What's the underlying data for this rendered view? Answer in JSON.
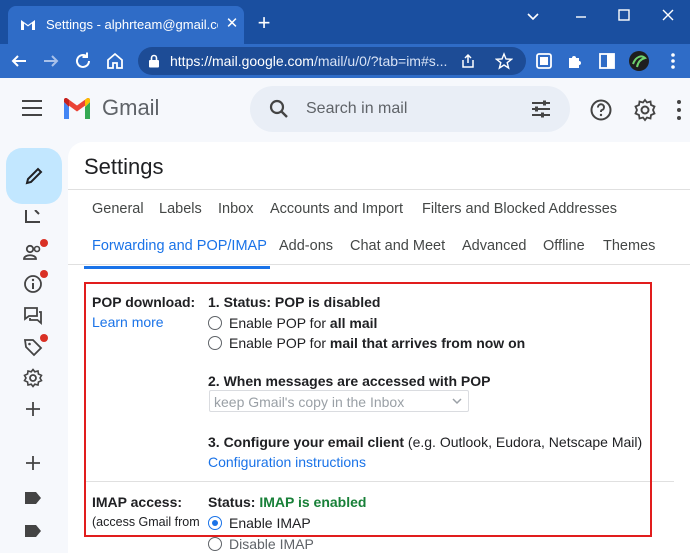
{
  "browser": {
    "tab_title": "Settings - alphrteam@gmail.com",
    "tab_close": "✕",
    "new_tab": "+",
    "url_host": "https://mail.google.com",
    "url_path": "/mail/u/0/?tab=im#s..."
  },
  "gmail": {
    "logo_text": "Gmail",
    "search_placeholder": "Search in mail"
  },
  "settings": {
    "title": "Settings",
    "tabs_row1": [
      "General",
      "Labels",
      "Inbox",
      "Accounts and Import",
      "Filters and Blocked Addresses"
    ],
    "tabs_row2": [
      "Forwarding and POP/IMAP",
      "Add-ons",
      "Chat and Meet",
      "Advanced",
      "Offline",
      "Themes"
    ],
    "active_tab": "Forwarding and POP/IMAP",
    "pop": {
      "label": "POP download:",
      "learn_more": "Learn more",
      "status_heading": "1. Status: POP is disabled",
      "option1_prefix": "Enable POP for ",
      "option1_bold": "all mail",
      "option2_prefix": "Enable POP for ",
      "option2_bold": "mail that arrives from now on",
      "when_heading": "2. When messages are accessed with POP",
      "when_select": "keep Gmail's copy in the Inbox",
      "configure_heading": "3. Configure your email client",
      "configure_examples": " (e.g. Outlook, Eudora, Netscape Mail)",
      "configure_link": "Configuration instructions"
    },
    "imap": {
      "label": "IMAP access:",
      "sublabel": "(access Gmail from",
      "status_prefix": "Status: ",
      "status_value": "IMAP is enabled",
      "option_enable": "Enable IMAP",
      "option_disable": "Disable IMAP"
    }
  },
  "colors": {
    "highlight": "#e11d1d",
    "link": "#1a73e8",
    "enabled_green": "#188038",
    "titlebar": "#1a4fa0"
  }
}
